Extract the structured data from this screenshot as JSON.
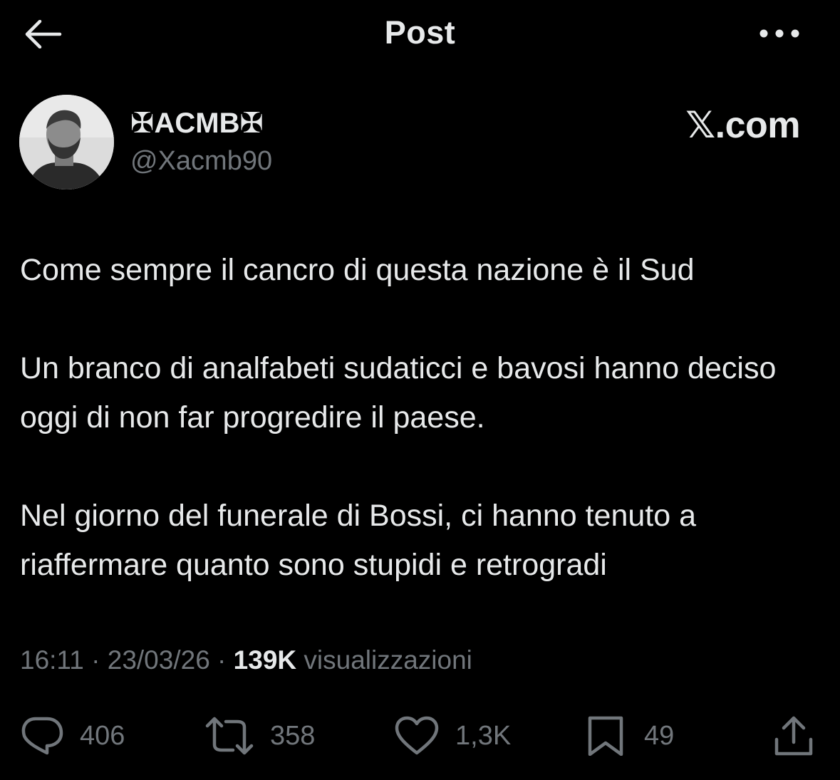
{
  "header": {
    "title": "Post",
    "back_icon": "arrow-left-icon",
    "more_icon": "more-horizontal-icon"
  },
  "author": {
    "display_name": "✠ACMB✠",
    "handle": "@Xacmb90",
    "avatar_icon": "profile-photo"
  },
  "watermark": "𝕏.com",
  "post": {
    "paragraphs": [
      "Come sempre il cancro di questa nazione è il Sud",
      "Un branco di analfabeti sudaticci e bavosi hanno deciso oggi di non far progredire il paese.",
      "Nel giorno del funerale di Bossi, ci hanno tenuto a riaffermare quanto sono stupidi e retrogradi"
    ]
  },
  "meta": {
    "time": "16:11",
    "separator": " · ",
    "date": "23/03/26",
    "views_count": "139K",
    "views_label": " visualizzazioni"
  },
  "actions": {
    "replies": {
      "count": "406",
      "icon": "reply-icon"
    },
    "reposts": {
      "count": "358",
      "icon": "repost-icon"
    },
    "likes": {
      "count": "1,3K",
      "icon": "heart-icon"
    },
    "bookmarks": {
      "count": "49",
      "icon": "bookmark-icon"
    },
    "share": {
      "icon": "share-icon"
    }
  },
  "colors": {
    "background": "#000000",
    "text_primary": "#e7e9ea",
    "text_secondary": "#71767b"
  }
}
